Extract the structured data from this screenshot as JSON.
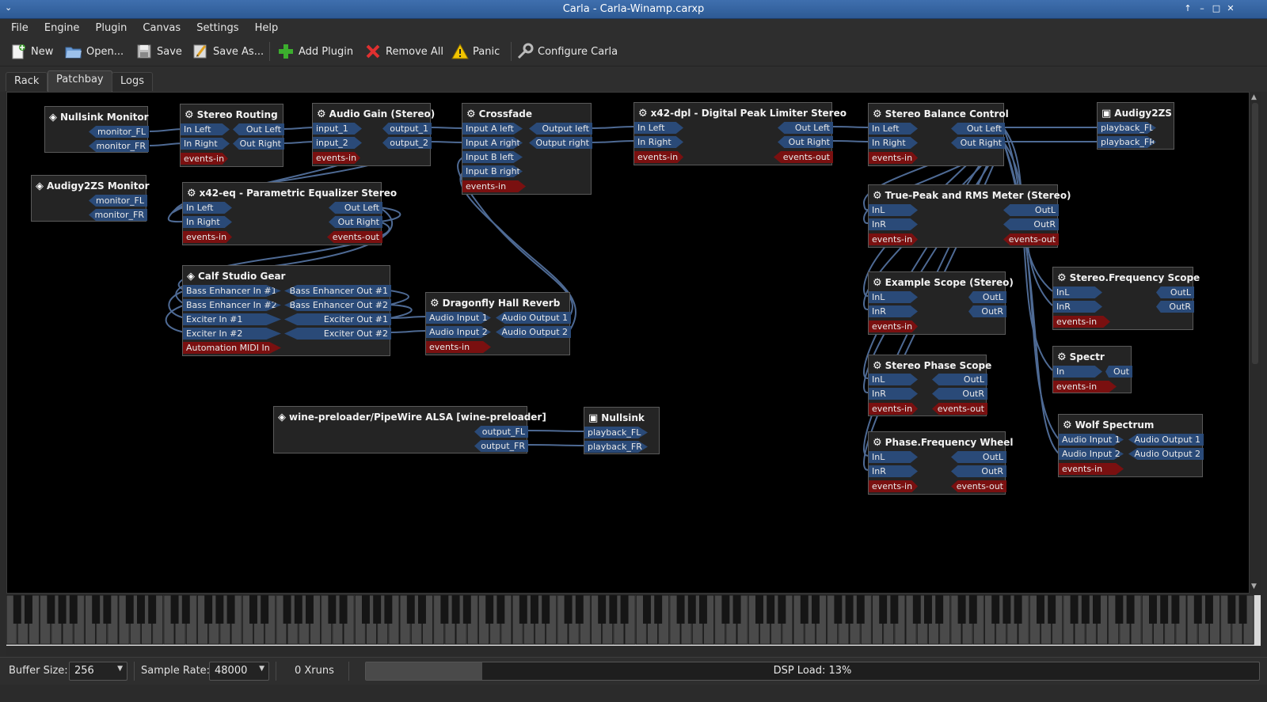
{
  "window": {
    "title": "Carla - Carla-Winamp.carxp"
  },
  "menu": [
    "File",
    "Engine",
    "Plugin",
    "Canvas",
    "Settings",
    "Help"
  ],
  "toolbar": {
    "new": "New",
    "open": "Open...",
    "save": "Save",
    "save_as": "Save As...",
    "add_plugin": "Add Plugin",
    "remove_all": "Remove All",
    "panic": "Panic",
    "configure": "Configure Carla"
  },
  "tabs": [
    "Rack",
    "Patchbay",
    "Logs"
  ],
  "active_tab": "Patchbay",
  "patchbay": {
    "nullsink_monitor": {
      "title": "Nullsink Monitor",
      "ports": [
        "monitor_FL",
        "monitor_FR"
      ]
    },
    "audigy_monitor": {
      "title": "Audigy2ZS Monitor",
      "ports": [
        "monitor_FL",
        "monitor_FR"
      ]
    },
    "stereo_routing": {
      "title": "Stereo Routing",
      "in": [
        "In Left",
        "In Right"
      ],
      "out": [
        "Out Left",
        "Out Right"
      ],
      "events": "events-in"
    },
    "audio_gain": {
      "title": "Audio Gain (Stereo)",
      "in": [
        "input_1",
        "input_2"
      ],
      "out": [
        "output_1",
        "output_2"
      ],
      "events": "events-in"
    },
    "crossfade": {
      "title": "Crossfade",
      "in": [
        "Input A left",
        "Input A right",
        "Input B left",
        "Input B right"
      ],
      "out": [
        "Output left",
        "Output right"
      ],
      "events": "events-in"
    },
    "x42_dpl": {
      "title": "x42-dpl - Digital Peak Limiter Stereo",
      "in": [
        "In Left",
        "In Right"
      ],
      "out": [
        "Out Left",
        "Out Right"
      ],
      "events_in": "events-in",
      "events_out": "events-out"
    },
    "balance": {
      "title": "Stereo Balance Control",
      "in": [
        "In Left",
        "In Right"
      ],
      "out": [
        "Out Left",
        "Out Right"
      ],
      "events": "events-in"
    },
    "audigy": {
      "title": "Audigy2ZS",
      "ports": [
        "playback_FL",
        "playback_FR"
      ]
    },
    "x42_eq": {
      "title": "x42-eq - Parametric Equalizer Stereo",
      "in": [
        "In Left",
        "In Right"
      ],
      "out": [
        "Out Left",
        "Out Right"
      ],
      "events_in": "events-in",
      "events_out": "events-out"
    },
    "truepeak": {
      "title": "True-Peak and RMS Meter (Stereo)",
      "in": [
        "InL",
        "InR"
      ],
      "out": [
        "OutL",
        "OutR"
      ],
      "events_in": "events-in",
      "events_out": "events-out"
    },
    "calf": {
      "title": "Calf Studio Gear",
      "in": [
        "Bass Enhancer In #1",
        "Bass Enhancer In #2",
        "Exciter In #1",
        "Exciter In #2"
      ],
      "out": [
        "Bass Enhancer Out #1",
        "Bass Enhancer Out #2",
        "Exciter Out #1",
        "Exciter Out #2"
      ],
      "events": "Automation MIDI In"
    },
    "dragonfly": {
      "title": "Dragonfly Hall Reverb",
      "in": [
        "Audio Input 1",
        "Audio Input 2"
      ],
      "out": [
        "Audio Output 1",
        "Audio Output 2"
      ],
      "events": "events-in"
    },
    "example_scope": {
      "title": "Example Scope (Stereo)",
      "in": [
        "InL",
        "InR"
      ],
      "out": [
        "OutL",
        "OutR"
      ],
      "events": "events-in"
    },
    "freq_scope": {
      "title": "Stereo.Frequency Scope",
      "in": [
        "InL",
        "InR"
      ],
      "out": [
        "OutL",
        "OutR"
      ],
      "events": "events-in"
    },
    "spectr": {
      "title": "Spectr",
      "in": [
        "In"
      ],
      "out": [
        "Out"
      ],
      "events": "events-in"
    },
    "phase_scope": {
      "title": "Stereo Phase Scope",
      "in": [
        "InL",
        "InR"
      ],
      "out": [
        "OutL",
        "OutR"
      ],
      "events_in": "events-in",
      "events_out": "events-out"
    },
    "phase_wheel": {
      "title": "Phase.Frequency Wheel",
      "in": [
        "InL",
        "InR"
      ],
      "out": [
        "OutL",
        "OutR"
      ],
      "events_in": "events-in",
      "events_out": "events-out"
    },
    "wolf": {
      "title": "Wolf Spectrum",
      "in": [
        "Audio Input 1",
        "Audio Input 2"
      ],
      "out": [
        "Audio Output 1",
        "Audio Output 2"
      ],
      "events": "events-in"
    },
    "wine": {
      "title": "wine-preloader/PipeWire ALSA [wine-preloader]",
      "out": [
        "output_FL",
        "output_FR"
      ]
    },
    "nullsink": {
      "title": "Nullsink",
      "ports": [
        "playback_FL",
        "playback_FR"
      ]
    }
  },
  "status": {
    "buffer_label": "Buffer Size:",
    "buffer_value": "256",
    "rate_label": "Sample Rate:",
    "rate_value": "48000",
    "xruns": "0 Xruns",
    "dsp_load": "DSP Load: 13%",
    "dsp_load_fraction": 0.13
  }
}
